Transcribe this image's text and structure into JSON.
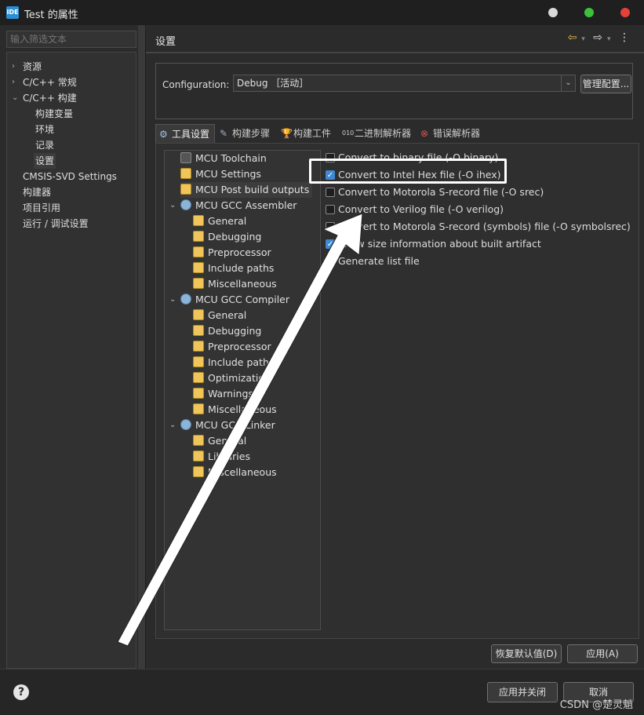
{
  "window": {
    "badge": "IDE",
    "title": "Test 的属性"
  },
  "left": {
    "filter_placeholder": "输入筛选文本",
    "items": [
      {
        "label": "资源",
        "chevron": "›"
      },
      {
        "label": "C/C++ 常规",
        "chevron": "›"
      },
      {
        "label": "C/C++ 构建",
        "chevron": "⌄"
      },
      {
        "label": "构建变量",
        "chevron": ""
      },
      {
        "label": "环境",
        "chevron": ""
      },
      {
        "label": "记录",
        "chevron": ""
      },
      {
        "label": "设置",
        "chevron": ""
      },
      {
        "label": "CMSIS-SVD Settings",
        "chevron": ""
      },
      {
        "label": "构建器",
        "chevron": ""
      },
      {
        "label": "项目引用",
        "chevron": ""
      },
      {
        "label": "运行 / 调试设置",
        "chevron": ""
      }
    ]
  },
  "main": {
    "title": "设置",
    "config": {
      "label": "Configuration:",
      "value": "Debug ［活动］",
      "manage_button": "管理配置..."
    },
    "tabs": [
      {
        "label": "工具设置",
        "icon": "⚙"
      },
      {
        "label": "构建步骤",
        "icon": "✎"
      },
      {
        "label": "构建工件",
        "icon": "🏆"
      },
      {
        "label": "二进制解析器",
        "icon": "010"
      },
      {
        "label": "错误解析器",
        "icon": "⊗"
      }
    ],
    "tool_tree": [
      {
        "label": "MCU Toolchain",
        "icon": "chip",
        "chev": ""
      },
      {
        "label": "MCU Settings",
        "icon": "folder",
        "chev": ""
      },
      {
        "label": "MCU Post build outputs",
        "icon": "folder",
        "chev": ""
      },
      {
        "label": "MCU GCC Assembler",
        "icon": "gear",
        "chev": "⌄"
      },
      {
        "label": "General",
        "icon": "folder",
        "chev": ""
      },
      {
        "label": "Debugging",
        "icon": "folder",
        "chev": ""
      },
      {
        "label": "Preprocessor",
        "icon": "folder",
        "chev": ""
      },
      {
        "label": "Include paths",
        "icon": "folder",
        "chev": ""
      },
      {
        "label": "Miscellaneous",
        "icon": "folder",
        "chev": ""
      },
      {
        "label": "MCU GCC Compiler",
        "icon": "gear",
        "chev": "⌄"
      },
      {
        "label": "General",
        "icon": "folder",
        "chev": ""
      },
      {
        "label": "Debugging",
        "icon": "folder",
        "chev": ""
      },
      {
        "label": "Preprocessor",
        "icon": "folder",
        "chev": ""
      },
      {
        "label": "Include paths",
        "icon": "folder",
        "chev": ""
      },
      {
        "label": "Optimization",
        "icon": "folder",
        "chev": ""
      },
      {
        "label": "Warnings",
        "icon": "folder",
        "chev": ""
      },
      {
        "label": "Miscellaneous",
        "icon": "folder",
        "chev": ""
      },
      {
        "label": "MCU GCC Linker",
        "icon": "gear",
        "chev": "⌄"
      },
      {
        "label": "General",
        "icon": "folder",
        "chev": ""
      },
      {
        "label": "Libraries",
        "icon": "folder",
        "chev": ""
      },
      {
        "label": "Miscellaneous",
        "icon": "folder",
        "chev": ""
      }
    ],
    "options": [
      {
        "label": "Convert to binary file (-O binary)",
        "checked": false
      },
      {
        "label": "Convert to Intel Hex file (-O ihex)",
        "checked": true
      },
      {
        "label": "Convert to Motorola S-record file (-O srec)",
        "checked": false
      },
      {
        "label": "Convert to Verilog file (-O verilog)",
        "checked": false
      },
      {
        "label": "Convert to Motorola S-record (symbols) file (-O symbolsrec)",
        "checked": false
      },
      {
        "label": "Show size information about built artifact",
        "checked": true
      },
      {
        "label": "Generate list file",
        "checked": true
      }
    ],
    "restore_button": "恢复默认值(D)",
    "apply_button": "应用(A)"
  },
  "footer": {
    "help": "?",
    "apply_close_button": "应用并关闭",
    "cancel_button": "取消",
    "watermark": "CSDN @楚灵魈"
  },
  "colors": {
    "accent": "#3f88d4",
    "highlight": "#ffffff"
  }
}
